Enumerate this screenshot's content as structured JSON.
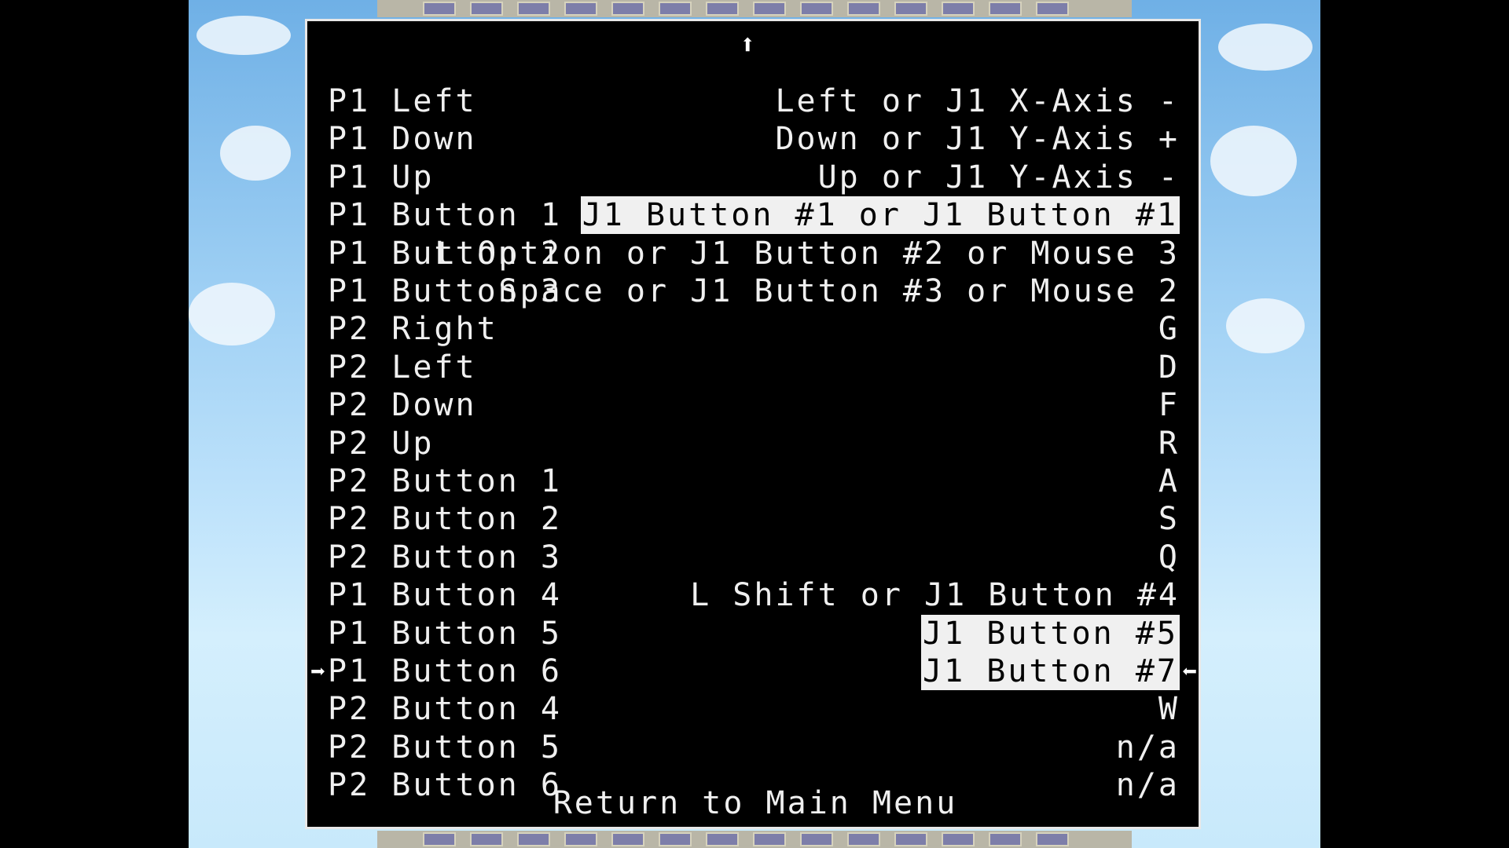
{
  "menu": {
    "scroll_indicator": "⬆",
    "bindings": [
      {
        "action": "P1 Left",
        "keys": "Left or J1 X-Axis -",
        "highlighted": false
      },
      {
        "action": "P1 Down",
        "keys": "Down or J1 Y-Axis +",
        "highlighted": false
      },
      {
        "action": "P1 Up",
        "keys": "Up or J1 Y-Axis -",
        "highlighted": false
      },
      {
        "action": "P1 Button 1",
        "keys": "J1 Button #1 or J1 Button #1",
        "highlighted": true
      },
      {
        "action": "P1 Button 2",
        "keys": "L Option or J1 Button #2 or Mouse 3",
        "highlighted": false
      },
      {
        "action": "P1 Button 3",
        "keys": "Space or J1 Button #3 or Mouse 2",
        "highlighted": false
      },
      {
        "action": "P2 Right",
        "keys": "G",
        "highlighted": false
      },
      {
        "action": "P2 Left",
        "keys": "D",
        "highlighted": false
      },
      {
        "action": "P2 Down",
        "keys": "F",
        "highlighted": false
      },
      {
        "action": "P2 Up",
        "keys": "R",
        "highlighted": false
      },
      {
        "action": "P2 Button 1",
        "keys": "A",
        "highlighted": false
      },
      {
        "action": "P2 Button 2",
        "keys": "S",
        "highlighted": false
      },
      {
        "action": "P2 Button 3",
        "keys": "Q",
        "highlighted": false
      },
      {
        "action": "P1 Button 4",
        "keys": "L Shift or J1 Button #4",
        "highlighted": false
      },
      {
        "action": "P1 Button 5",
        "keys": "J1 Button #5",
        "highlighted": true
      },
      {
        "action": "P1 Button 6",
        "keys": "J1 Button #7",
        "highlighted": true,
        "selected": true
      },
      {
        "action": "P2 Button 4",
        "keys": "W",
        "highlighted": false
      },
      {
        "action": "P2 Button 5",
        "keys": "n/a",
        "highlighted": false
      },
      {
        "action": "P2 Button 6",
        "keys": "n/a",
        "highlighted": false
      }
    ],
    "cursor_left": "➡",
    "cursor_right": "⬅",
    "return_label": "Return to Main Menu"
  },
  "colors": {
    "panel_background": "#000000",
    "text": "#f0f0f0",
    "highlight_background": "#f0f0f0",
    "sky": "#9fd0f4"
  }
}
